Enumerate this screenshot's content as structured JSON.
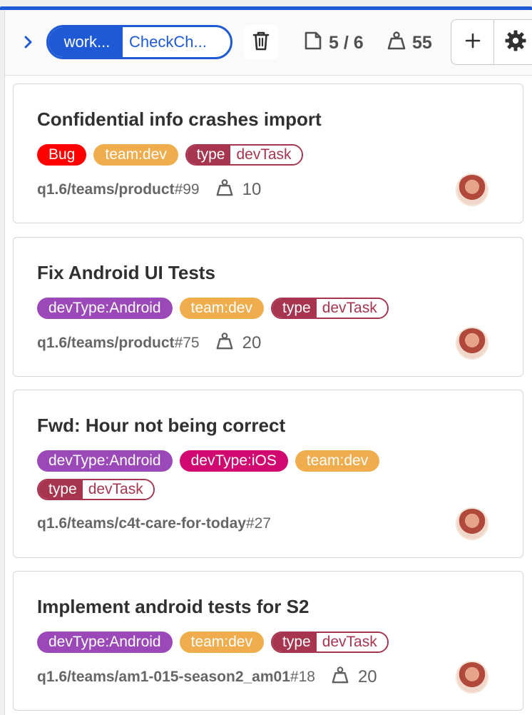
{
  "header": {
    "expand_icon": "chevron-right-icon",
    "view_tabs": {
      "active_label": "work...",
      "inactive_label": "CheckCh..."
    },
    "delete_icon": "trash-icon",
    "issues_stat": {
      "icon": "issues-icon",
      "value": "5 / 6"
    },
    "weight_stat": {
      "icon": "weight-icon",
      "value": "55"
    },
    "add_icon": "plus-icon",
    "settings_icon": "gear-icon"
  },
  "colors": {
    "accent": "#1f5ad6",
    "bug": "#ff0000",
    "team_dev": "#f0ad4e",
    "devtype_android": "#9b48b8",
    "devtype_ios": "#d1086f",
    "type_scoped": "#a8354f"
  },
  "cards": [
    {
      "title": "Confidential info crashes import",
      "labels": [
        {
          "kind": "plain",
          "text": "Bug",
          "color": "#ff0000"
        },
        {
          "kind": "plain",
          "text": "team:dev",
          "color": "#f0ad4e"
        },
        {
          "kind": "scoped",
          "key": "type",
          "value": "devTask",
          "color": "#a8354f"
        }
      ],
      "ref_path": "q1.6/teams/product",
      "ref_num": "#99",
      "weight": "10"
    },
    {
      "title": "Fix Android UI Tests",
      "labels": [
        {
          "kind": "plain",
          "text": "devType:Android",
          "color": "#9b48b8"
        },
        {
          "kind": "plain",
          "text": "team:dev",
          "color": "#f0ad4e"
        },
        {
          "kind": "scoped",
          "key": "type",
          "value": "devTask",
          "color": "#a8354f"
        }
      ],
      "ref_path": "q1.6/teams/product",
      "ref_num": "#75",
      "weight": "20"
    },
    {
      "title": "Fwd: Hour not being correct",
      "labels": [
        {
          "kind": "plain",
          "text": "devType:Android",
          "color": "#9b48b8"
        },
        {
          "kind": "plain",
          "text": "devType:iOS",
          "color": "#d1086f"
        },
        {
          "kind": "plain",
          "text": "team:dev",
          "color": "#f0ad4e"
        },
        {
          "kind": "scoped",
          "key": "type",
          "value": "devTask",
          "color": "#a8354f"
        }
      ],
      "ref_path": "q1.6/teams/c4t-care-for-today",
      "ref_num": "#27",
      "weight": null
    },
    {
      "title": "Implement android tests for S2",
      "labels": [
        {
          "kind": "plain",
          "text": "devType:Android",
          "color": "#9b48b8"
        },
        {
          "kind": "plain",
          "text": "team:dev",
          "color": "#f0ad4e"
        },
        {
          "kind": "scoped",
          "key": "type",
          "value": "devTask",
          "color": "#a8354f"
        }
      ],
      "ref_path": "q1.6/teams/am1-015-season2_am01",
      "ref_num": "#18",
      "weight": "20"
    }
  ]
}
